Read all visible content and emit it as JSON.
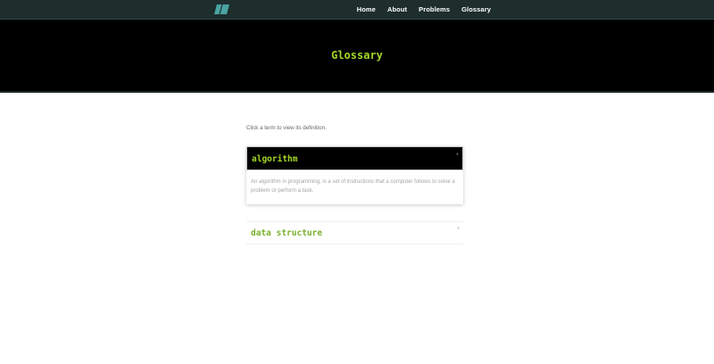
{
  "colors": {
    "navbar_bg": "#1d2e2d",
    "hero_bg": "#000000",
    "accent_green": "#a3d628",
    "term_green_closed": "#79b02c",
    "logo": "#4aa3a3"
  },
  "navbar": {
    "logo_icon": "logo-parallelogram-icon",
    "links": [
      {
        "label": "Home"
      },
      {
        "label": "About"
      },
      {
        "label": "Problems"
      },
      {
        "label": "Glossary"
      }
    ]
  },
  "hero": {
    "title": "Glossary"
  },
  "main": {
    "intro": "Click a term to view its definition.",
    "terms": [
      {
        "term": "algorithm",
        "expanded": true,
        "chevron_icon": "chevron-up-icon",
        "definition": "An algorithm in programming, is a set of instructions that a computer follows to solve a problem or perform a task."
      },
      {
        "term": "data structure",
        "expanded": false,
        "chevron_icon": "chevron-down-icon",
        "definition": ""
      }
    ]
  }
}
